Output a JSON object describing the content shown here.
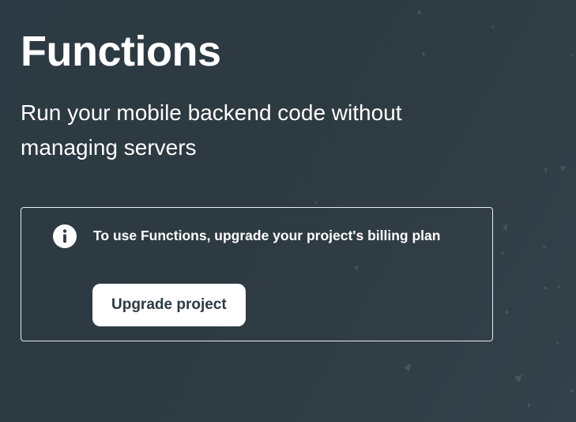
{
  "page": {
    "title": "Functions",
    "subtitle": "Run your mobile backend code without managing servers"
  },
  "notice": {
    "icon": "info-icon",
    "message": "To use Functions, upgrade your project's billing plan",
    "button_label": "Upgrade project"
  },
  "colors": {
    "background": "#2e3a41",
    "text": "#ffffff",
    "button_background": "#ffffff",
    "button_text": "#2d3a42",
    "notice_border": "#e7ebee"
  }
}
